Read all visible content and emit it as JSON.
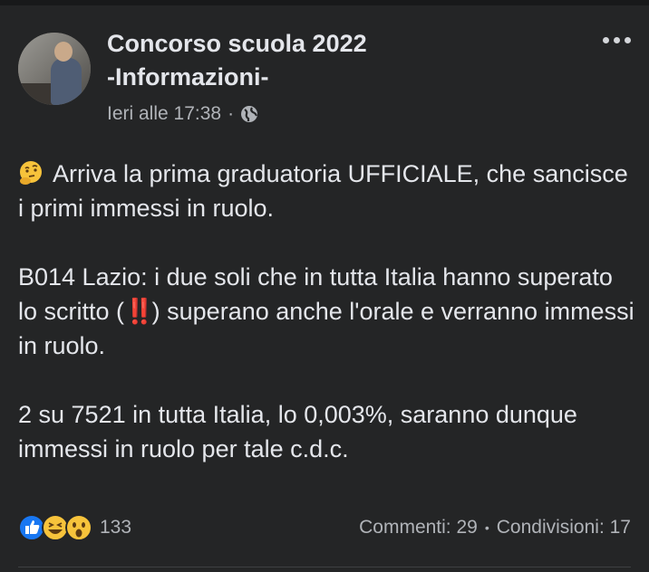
{
  "post": {
    "page_name_line1": "Concorso scuola 2022",
    "page_name_line2": "-Informazioni-",
    "timestamp": "Ieri alle 17:38",
    "separator": "·",
    "privacy_icon": "globe-icon",
    "more_icon": "more-options-icon",
    "emoji_intro": "thinking-face-emoji",
    "paragraph1": "Arriva la prima graduatoria UFFICIALE, che sancisce i primi immessi in ruolo.",
    "paragraph2_before": "B014 Lazio: i due soli che in tutta Italia hanno superato lo scritto (",
    "paragraph2_bang": "‼️",
    "paragraph2_after": ") superano anche l'orale e verranno immessi in ruolo.",
    "paragraph3": "2 su 7521 in tutta Italia, lo 0,003%, saranno dunque immessi in ruolo per tale c.d.c."
  },
  "footer": {
    "reaction_icons": [
      "like-icon",
      "laugh-icon",
      "wow-icon"
    ],
    "reaction_count": "133",
    "comments": "Commenti: 29",
    "stats_separator": "•",
    "shares": "Condivisioni: 17"
  },
  "colors": {
    "background": "#242526",
    "text_primary": "#e4e6eb",
    "text_secondary": "#b0b3b8",
    "like_blue": "#1877f2",
    "emoji_yellow": "#f7c33b"
  }
}
